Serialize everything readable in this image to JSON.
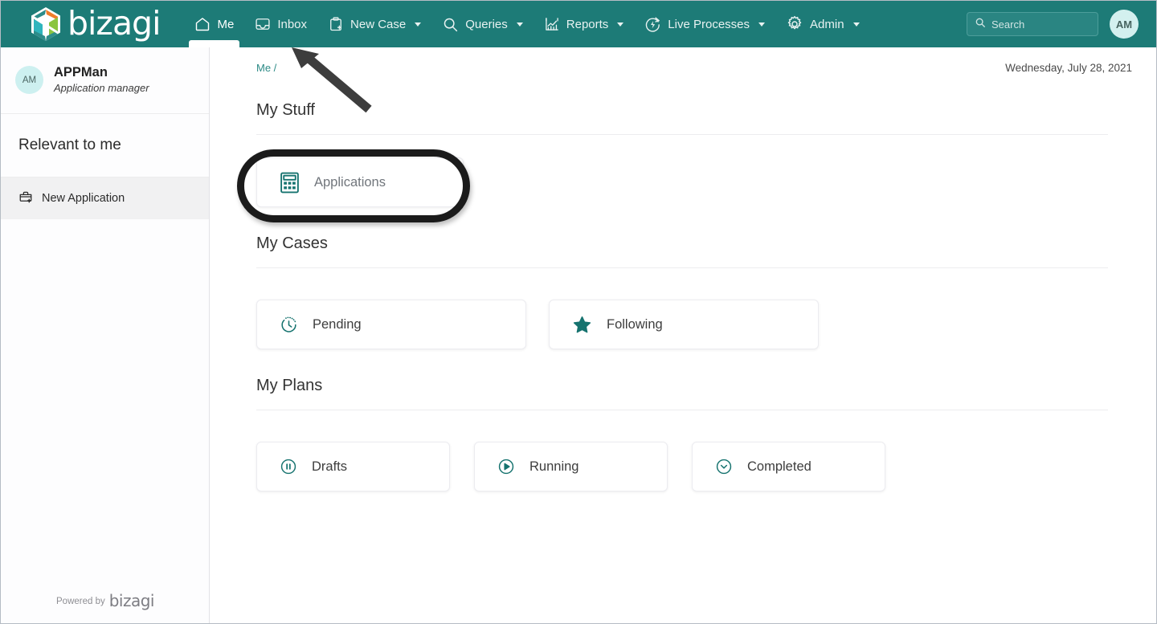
{
  "app": {
    "brand": "bizagi",
    "powered_by_label": "Powered by",
    "powered_by_brand": "bizagi"
  },
  "header": {
    "nav": [
      {
        "label": "Me",
        "icon": "home-icon",
        "active": true,
        "has_caret": false
      },
      {
        "label": "Inbox",
        "icon": "inbox-icon",
        "active": false,
        "has_caret": false
      },
      {
        "label": "New Case",
        "icon": "clipboard-plus-icon",
        "active": false,
        "has_caret": true
      },
      {
        "label": "Queries",
        "icon": "search-icon",
        "active": false,
        "has_caret": true
      },
      {
        "label": "Reports",
        "icon": "chart-icon",
        "active": false,
        "has_caret": true
      },
      {
        "label": "Live Processes",
        "icon": "lightning-circle-icon",
        "active": false,
        "has_caret": true
      },
      {
        "label": "Admin",
        "icon": "gear-icon",
        "active": false,
        "has_caret": true
      }
    ],
    "search": {
      "placeholder": "Search",
      "value": ""
    },
    "avatar": {
      "initials": "AM"
    }
  },
  "sidebar": {
    "user": {
      "initials": "AM",
      "name": "APPMan",
      "role": "Application manager"
    },
    "heading": "Relevant to me",
    "items": [
      {
        "label": "New Application",
        "icon": "briefcase-plus-icon",
        "selected": true
      }
    ]
  },
  "main": {
    "breadcrumb": "Me /",
    "date": "Wednesday, July 28, 2021",
    "sections": [
      {
        "title": "My Stuff",
        "cards": [
          {
            "label": "Applications",
            "icon": "calculator-icon"
          }
        ]
      },
      {
        "title": "My Cases",
        "cards": [
          {
            "label": "Pending",
            "icon": "clock-icon"
          },
          {
            "label": "Following",
            "icon": "star-icon"
          }
        ]
      },
      {
        "title": "My Plans",
        "cards": [
          {
            "label": "Drafts",
            "icon": "pause-circle-icon"
          },
          {
            "label": "Running",
            "icon": "play-circle-icon"
          },
          {
            "label": "Completed",
            "icon": "chevron-down-circle-icon"
          }
        ]
      }
    ]
  },
  "annotations": {
    "highlight_target": "Applications",
    "arrow_target": "Me"
  },
  "colors": {
    "header_teal": "#1d7b77",
    "accent_teal": "#2c8a86",
    "icon_teal": "#16736f",
    "sidebar_selected": "#f1f1f2",
    "annotation_black": "#1b1b1b"
  }
}
